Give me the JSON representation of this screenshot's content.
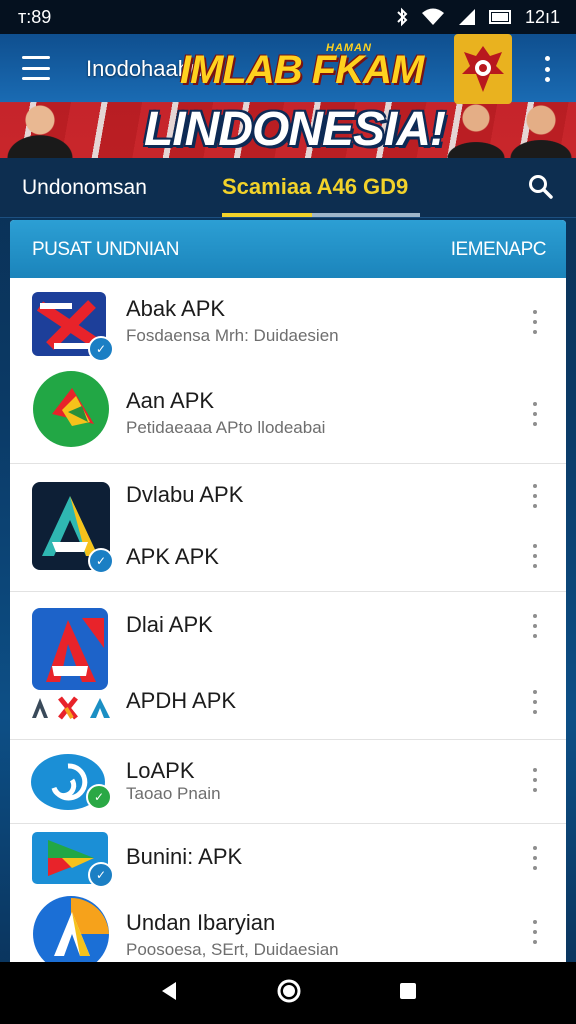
{
  "status_bar": {
    "time": "ᴛ:89",
    "clock": "12ı1"
  },
  "app_bar": {
    "title": "Inodohaahn",
    "banner_small": "HAMAN",
    "banner_headline": "IMLAB FKAM",
    "banner_big": "LINDONESIA!"
  },
  "tabs": {
    "left": "Undonomsan",
    "center": "Scamiaa A46 GD9"
  },
  "card": {
    "header_left": "PUSAT UNDNIAN",
    "header_right": "IEMENAPC",
    "items": [
      {
        "title": "Abak APK",
        "subtitle": "Fosdaensa Mrh: Duidaesien"
      },
      {
        "title": "Aan APK",
        "subtitle": "Petidaeaaa APto llodeabai"
      },
      {
        "title": "Dvlabu APK"
      },
      {
        "title": "APK APK"
      },
      {
        "title": "Dlai APK"
      },
      {
        "title": "APDH APK"
      },
      {
        "title": "LoAPK",
        "subtitle": "Taoao Pnain"
      },
      {
        "title": "Bunini: APK"
      },
      {
        "title": "Undan Ibaryian",
        "subtitle": "Poosoesa, SErt, Duidaesian"
      }
    ]
  },
  "colors": {
    "accent": "#f2d22a",
    "header_blue": "#1b84bb",
    "background": "#0b3a66"
  }
}
